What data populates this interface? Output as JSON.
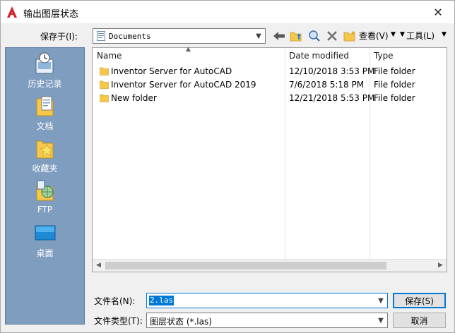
{
  "window": {
    "title": "输出图层状态",
    "close": "✕"
  },
  "toolbar": {
    "look_in_label": "保存于(I):",
    "look_in_value": "Documents",
    "views_label": "查看(V)",
    "tools_label": "工具(L)"
  },
  "places": [
    {
      "label": "历史记录",
      "icon": "history-icon"
    },
    {
      "label": "文档",
      "icon": "documents-icon"
    },
    {
      "label": "收藏夹",
      "icon": "favorites-icon"
    },
    {
      "label": "FTP",
      "icon": "ftp-icon"
    },
    {
      "label": "桌面",
      "icon": "desktop-icon"
    }
  ],
  "filelist": {
    "columns": [
      "Name",
      "Date modified",
      "Type"
    ],
    "rows": [
      {
        "name": "Inventor Server for AutoCAD",
        "date": "12/10/2018 3:53 PM",
        "type": "File folder"
      },
      {
        "name": "Inventor Server for AutoCAD 2019",
        "date": "7/6/2018 5:18 PM",
        "type": "File folder"
      },
      {
        "name": "New folder",
        "date": "12/21/2018 5:53 PM",
        "type": "File folder"
      }
    ]
  },
  "bottom": {
    "filename_label": "文件名(N):",
    "filename_value": "2.las",
    "filetype_label": "文件类型(T):",
    "filetype_value": "图层状态 (*.las)",
    "save_label": "保存(S)",
    "cancel_label": "取消"
  },
  "colors": {
    "accent": "#0078d7",
    "places_bg": "#7f9dbf",
    "folder": "#f5c84c",
    "autocad_red": "#d4202a"
  }
}
